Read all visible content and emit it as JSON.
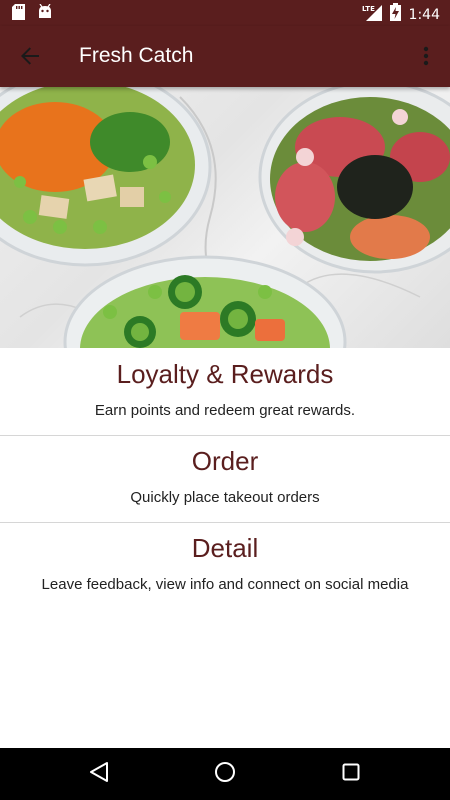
{
  "status_bar": {
    "time": "1:44",
    "network_label": "LTE",
    "icons": [
      "sd-card-icon",
      "android-debug-icon",
      "lte-signal-icon",
      "battery-charging-icon"
    ]
  },
  "app_bar": {
    "title": "Fresh Catch",
    "back_icon": "arrow-back-icon",
    "overflow_icon": "more-vert-icon"
  },
  "hero": {
    "image": "poke-bowls-photo"
  },
  "sections": [
    {
      "title": "Loyalty & Rewards",
      "description": "Earn points and redeem great rewards."
    },
    {
      "title": "Order",
      "description": "Quickly place takeout orders"
    },
    {
      "title": "Detail",
      "description": "Leave feedback, view info and connect on social media"
    }
  ],
  "nav_bar": {
    "buttons": [
      "back-triangle-icon",
      "home-circle-icon",
      "recents-square-icon"
    ]
  },
  "colors": {
    "primary": "#5a1e1e",
    "section_title": "#5a1e1e",
    "divider": "#d6d6d6",
    "nav_bar": "#000000"
  }
}
